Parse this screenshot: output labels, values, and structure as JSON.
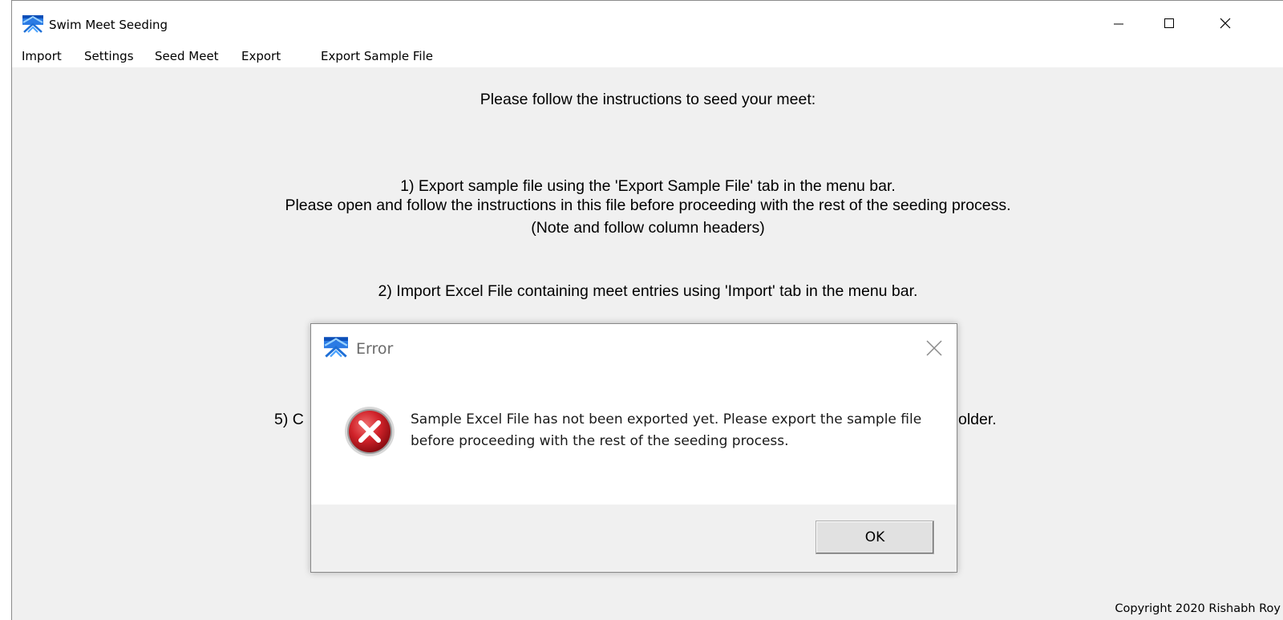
{
  "window": {
    "title": "Swim Meet Seeding",
    "icon": "swim-meet-icon"
  },
  "menu": {
    "items": [
      "Import",
      "Settings",
      "Seed Meet",
      "Export",
      "Export Sample File"
    ]
  },
  "main": {
    "heading": "Please follow the instructions to seed your meet:",
    "step1_line1": "1) Export sample file using the 'Export Sample File' tab in the menu bar.",
    "step1_line2": "Please open and follow the instructions in this file before proceeding with the rest of the seeding process.",
    "step1_line3": "(Note and follow column headers)",
    "step2": "2) Import Excel File containing meet entries using 'Import' tab in the menu bar.",
    "step5_prefix": "5) C",
    "step5_suffix": "older.",
    "copyright": "Copyright 2020 Rishabh Roy"
  },
  "dialog": {
    "title": "Error",
    "icon": "error-icon",
    "message": "Sample Excel File has not been exported yet. Please export the sample file before proceeding with the rest of the seeding process.",
    "ok_label": "OK"
  },
  "colors": {
    "error_red": "#c8161d",
    "app_icon_blue": "#1e6fd6"
  }
}
